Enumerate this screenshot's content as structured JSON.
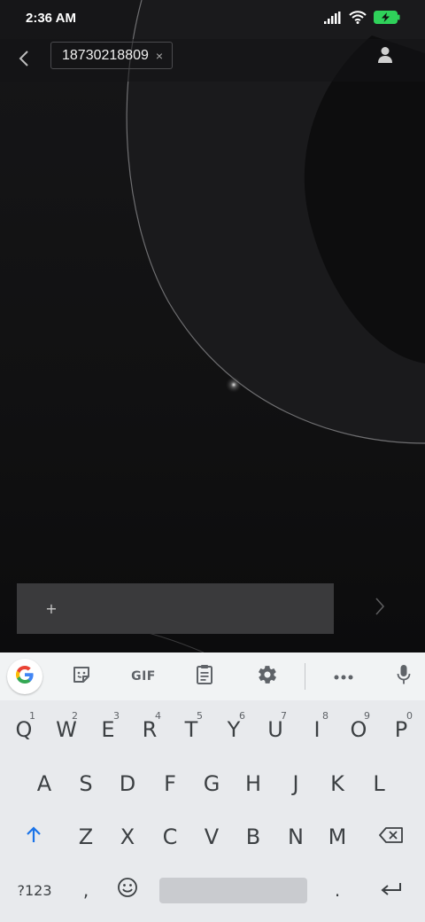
{
  "status_bar": {
    "time": "2:36 AM",
    "icons": [
      "signal-icon",
      "wifi-icon",
      "battery-charging-icon"
    ]
  },
  "header": {
    "back_icon": "chevron-left-icon",
    "recipient": "18730218809",
    "recipient_remove": "×",
    "contact_icon": "person-icon"
  },
  "compose": {
    "attach_label": "+",
    "send_icon": "chevron-right-icon"
  },
  "keyboard": {
    "toolbar": [
      "google-icon",
      "sticker-icon",
      "GIF",
      "clipboard-icon",
      "gear-icon",
      "more-icon",
      "mic-icon"
    ],
    "gif_label": "GIF",
    "row1": [
      {
        "key": "Q",
        "hint": "1"
      },
      {
        "key": "W",
        "hint": "2"
      },
      {
        "key": "E",
        "hint": "3"
      },
      {
        "key": "R",
        "hint": "4"
      },
      {
        "key": "T",
        "hint": "5"
      },
      {
        "key": "Y",
        "hint": "6"
      },
      {
        "key": "U",
        "hint": "7"
      },
      {
        "key": "I",
        "hint": "8"
      },
      {
        "key": "O",
        "hint": "9"
      },
      {
        "key": "P",
        "hint": "0"
      }
    ],
    "row2": [
      "A",
      "S",
      "D",
      "F",
      "G",
      "H",
      "J",
      "K",
      "L"
    ],
    "row3": [
      "Z",
      "X",
      "C",
      "V",
      "B",
      "N",
      "M"
    ],
    "symbols_label": "?123",
    "comma_label": ",",
    "period_label": ".",
    "colors": {
      "background": "#e8eaed",
      "toolbar": "#f1f3f4",
      "key_text": "#3c4043",
      "accent": "#1a73e8"
    }
  }
}
